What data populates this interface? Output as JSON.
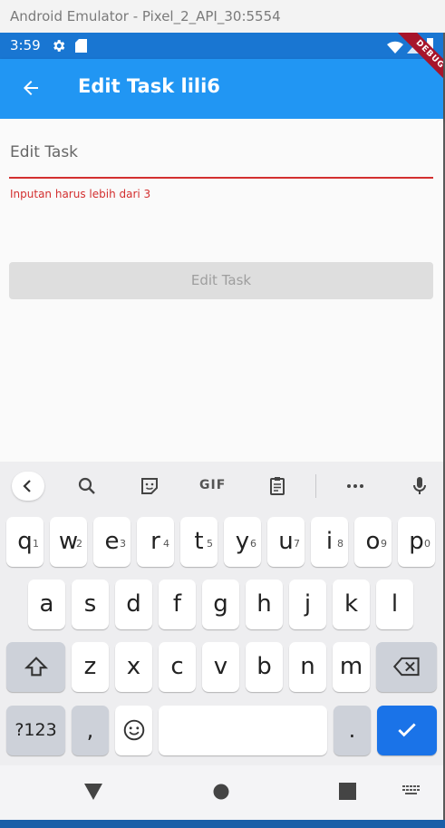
{
  "emulator": {
    "title": "Android Emulator - Pixel_2_API_30:5554"
  },
  "status_bar": {
    "time": "3:59"
  },
  "debug_banner": {
    "label": "DEBUG"
  },
  "app_bar": {
    "title": "Edit Task lili6"
  },
  "form": {
    "field_label": "Edit Task",
    "field_value": "",
    "error_text": "Inputan harus lebih dari 3",
    "submit_label": "Edit Task"
  },
  "keyboard": {
    "toolbar": {
      "gif_label": "GIF"
    },
    "row1": [
      {
        "ch": "q",
        "hint": "1"
      },
      {
        "ch": "w",
        "hint": "2"
      },
      {
        "ch": "e",
        "hint": "3"
      },
      {
        "ch": "r",
        "hint": "4"
      },
      {
        "ch": "t",
        "hint": "5"
      },
      {
        "ch": "y",
        "hint": "6"
      },
      {
        "ch": "u",
        "hint": "7"
      },
      {
        "ch": "i",
        "hint": "8"
      },
      {
        "ch": "o",
        "hint": "9"
      },
      {
        "ch": "p",
        "hint": "0"
      }
    ],
    "row2": [
      "a",
      "s",
      "d",
      "f",
      "g",
      "h",
      "j",
      "k",
      "l"
    ],
    "row3": [
      "z",
      "x",
      "c",
      "v",
      "b",
      "n",
      "m"
    ],
    "symbols_label": "?123",
    "comma_label": ",",
    "period_label": "."
  },
  "colors": {
    "status_bar": "#1976d2",
    "app_bar": "#2196f3",
    "error": "#d32f2f",
    "debug": "#a7152b",
    "enter_key": "#1a73e8"
  }
}
